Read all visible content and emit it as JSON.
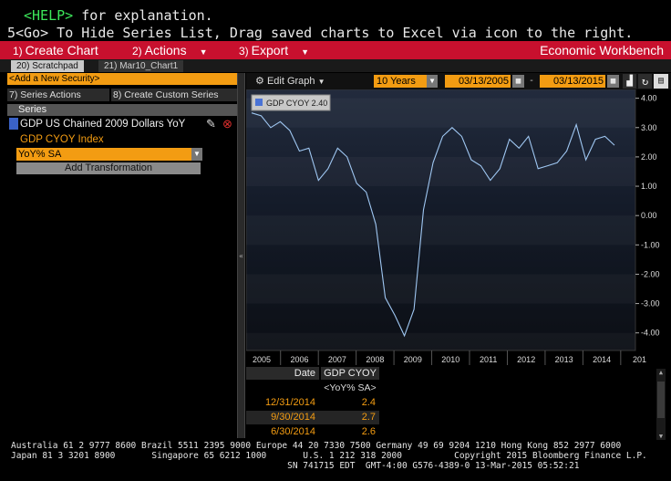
{
  "cmd": {
    "help_key": "<HELP>",
    "help_rest": " for explanation.",
    "line2": "5<Go> To Hide Series List, Drag saved charts to Excel via icon to the right."
  },
  "menu": {
    "create_num": "1)",
    "create_label": "Create Chart",
    "actions_num": "2)",
    "actions_label": "Actions",
    "export_num": "3)",
    "export_label": "Export",
    "workbench": "Economic Workbench"
  },
  "tabs": [
    {
      "label": "20) Scratchpad",
      "active": true
    },
    {
      "label": "21) Mar10_Chart1",
      "active": false
    }
  ],
  "left": {
    "add_security": "<Add a New Security>",
    "series_actions": "7) Series Actions",
    "create_custom": "8) Create Custom Series",
    "series_header": "Series",
    "series_name": "GDP US Chained 2009 Dollars YoY",
    "series_sub": "GDP CYOY Index",
    "transform_value": "YoY% SA",
    "add_transform": "Add Transformation"
  },
  "toolbar": {
    "edit_graph": "Edit Graph",
    "period": "10 Years",
    "start_date": "03/13/2005",
    "end_date": "03/13/2015"
  },
  "colors": {
    "amber": "#f39c12",
    "red_bar": "#c8102e",
    "line": "#9fc7f2",
    "band": "#1e2a44"
  },
  "chart_data": {
    "type": "line",
    "legend": "GDP CYOY 2.40",
    "x_labels": [
      "2005",
      "2006",
      "2007",
      "2008",
      "2009",
      "2010",
      "2011",
      "2012",
      "2013",
      "2014",
      "201"
    ],
    "ylim": [
      -4.6,
      4.3
    ],
    "y_ticks": [
      "4.00",
      "3.00",
      "2.00",
      "1.00",
      "0.00",
      "-1.00",
      "-2.00",
      "-3.00",
      "-4.00"
    ],
    "series": [
      {
        "values": [
          3.5,
          3.4,
          3.0,
          3.2,
          2.9,
          2.2,
          2.3,
          1.2,
          1.6,
          2.3,
          2.0,
          1.1,
          0.8,
          -0.3,
          -2.8,
          -3.4,
          -4.1,
          -3.2,
          0.2,
          1.8,
          2.7,
          3.0,
          2.7,
          1.9,
          1.7,
          1.2,
          1.6,
          2.6,
          2.3,
          2.7,
          1.6,
          1.7,
          1.8,
          2.2,
          3.1,
          1.9,
          2.6,
          2.7,
          2.4
        ]
      }
    ]
  },
  "table": {
    "col_date": "Date",
    "col_value": "GDP CYOY",
    "col_sub": "<YoY% SA>",
    "rows": [
      {
        "date": "12/31/2014",
        "value": "2.4"
      },
      {
        "date": "9/30/2014",
        "value": "2.7"
      },
      {
        "date": "6/30/2014",
        "value": "2.6"
      }
    ]
  },
  "footer": {
    "line1": "Australia 61 2 9777 8600 Brazil 5511 2395 9000 Europe 44 20 7330 7500 Germany 49 69 9204 1210 Hong Kong 852 2977 6000",
    "line2": "Japan 81 3 3201 8900       Singapore 65 6212 1000       U.S. 1 212 318 2000          Copyright 2015 Bloomberg Finance L.P.",
    "line3": "                                                     SN 741715 EDT  GMT-4:00 G576-4389-0 13-Mar-2015 05:52:21"
  }
}
